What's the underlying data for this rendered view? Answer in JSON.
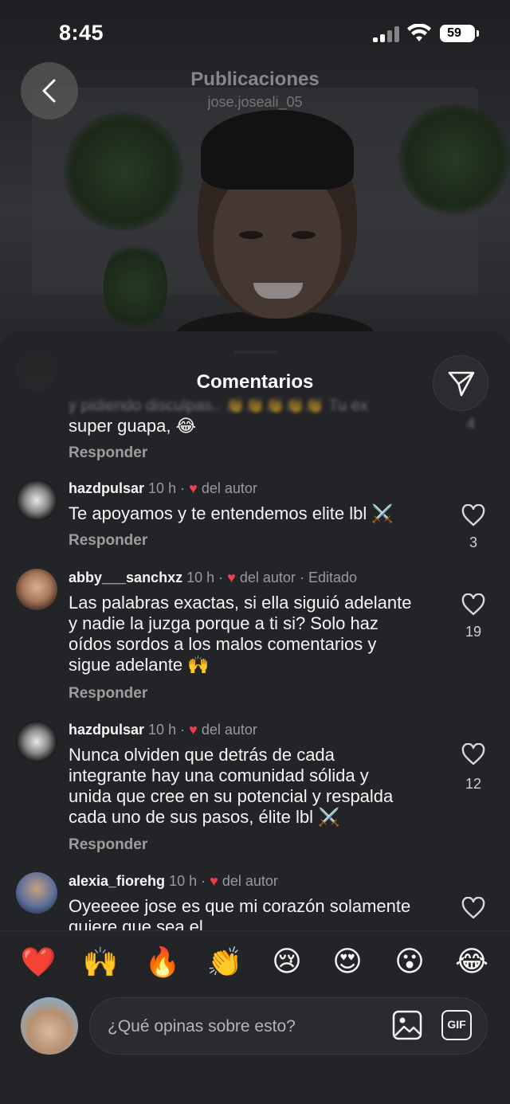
{
  "status_bar": {
    "time": "8:45",
    "battery": "59"
  },
  "background_header": {
    "title": "Publicaciones",
    "subtitle": "jose.joseali_05"
  },
  "sheet": {
    "title": "Comentarios"
  },
  "partial_comment": {
    "blurred_text": "y pidiendo disculpas.. 👏👏👏👏👏 Tu ex",
    "blurred_count": "4",
    "visible_tail": "super guapa, 😂",
    "reply_label": "Responder"
  },
  "comments": [
    {
      "username": "hazdpulsar",
      "time": "10 h",
      "liked_by_author": "del autor",
      "edited": "",
      "text_lines": [
        "Te apoyamos y te entendemos elite lbl ⚔️"
      ],
      "likes": "3",
      "reply_label": "Responder"
    },
    {
      "username": "abby___sanchxz",
      "time": "10 h",
      "liked_by_author": "del autor",
      "edited": "Editado",
      "text_lines": [
        "Las palabras exactas, si ella siguió adelante",
        "y nadie la juzga porque a ti si? Solo haz",
        "oídos sordos a los malos comentarios y",
        "sigue adelante 🙌"
      ],
      "likes": "19",
      "reply_label": "Responder"
    },
    {
      "username": "hazdpulsar",
      "time": "10 h",
      "liked_by_author": "del autor",
      "edited": "",
      "text_lines": [
        "Nunca olviden que detrás de cada",
        "integrante hay una comunidad sólida y",
        "unida que cree en su potencial y respalda",
        "cada uno de sus pasos, élite lbl ⚔️"
      ],
      "likes": "12",
      "reply_label": "Responder"
    },
    {
      "username": "alexia_fiorehg",
      "time": "10 h",
      "liked_by_author": "del autor",
      "edited": "",
      "text_lines": [
        "Oyeeeee jose es que mi corazón solamente",
        "quiere que sea el"
      ],
      "likes": "",
      "reply_label": ""
    }
  ],
  "emoji_reactions": [
    "❤️",
    "🙌",
    "🔥",
    "👏",
    "😢",
    "😍",
    "😮",
    "😂"
  ],
  "composer": {
    "placeholder": "¿Qué opinas sobre esto?",
    "gif_label": "GIF"
  },
  "colors": {
    "sheet_bg": "#232427",
    "heart_red": "#ef3e4a",
    "secondary_text": "#9a9a9a"
  }
}
